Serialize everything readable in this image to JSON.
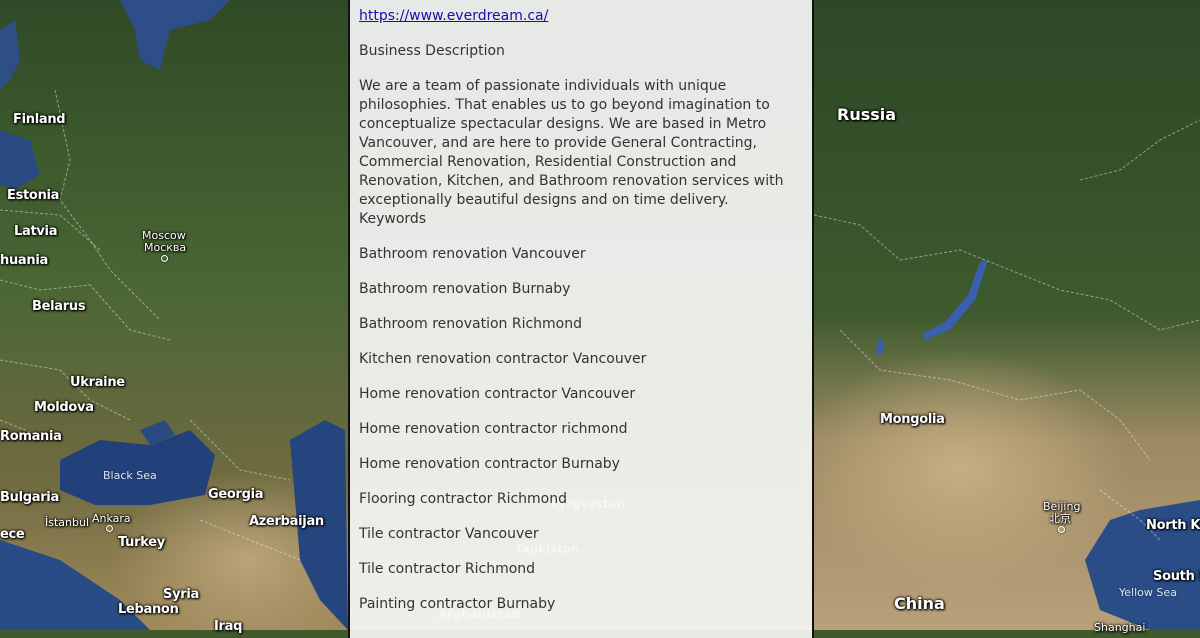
{
  "map": {
    "countries_left": [
      "Finland",
      "Estonia",
      "Latvia",
      "huania",
      "Belarus",
      "Ukraine",
      "Moldova",
      "Romania",
      "Bulgaria",
      "Georgia",
      "Azerbaijan",
      "Turkey",
      "Syria",
      "Lebanon",
      "Iraq",
      "ece"
    ],
    "cities": {
      "moscow": "Moscow",
      "moscow_native": "Москва",
      "istanbul": "İstanbul",
      "ankara": "Ankara",
      "beijing": "Beijing",
      "beijing_native": "北京",
      "shanghai": "Shanghai"
    },
    "seas": {
      "black_sea": "Black Sea",
      "yellow_sea": "Yellow Sea"
    },
    "countries_right": {
      "russia": "Russia",
      "mongolia": "Mongolia",
      "china": "China",
      "north_korea": "North Ko",
      "south_korea": "South K"
    },
    "under_panel": {
      "kyrgyzstan": "Kyrgyzstan",
      "tajikistan": "Tajikistan",
      "afghanistan": "Afghanistan"
    }
  },
  "panel": {
    "url": "https://www.everdream.ca/",
    "description_heading": "Business Description",
    "description": "We are a team of passionate individuals with unique philosophies. That enables us to go beyond imagination to conceptualize spectacular designs. We are based in Metro Vancouver, and are here to provide General Contracting, Commercial Renovation, Residential Construction and Renovation, Kitchen, and Bathroom renovation services with exceptionally beautiful designs and on time delivery.",
    "keywords_heading": "Keywords",
    "keywords": [
      "Bathroom renovation Vancouver",
      "Bathroom renovation Burnaby",
      "Bathroom renovation Richmond",
      "Kitchen renovation contractor Vancouver",
      "Home renovation contractor Vancouver",
      "Home renovation contractor richmond",
      "Home renovation contractor Burnaby",
      "Flooring contractor Richmond",
      "Tile contractor Vancouver",
      "Tile contractor Richmond",
      "Painting contractor Burnaby"
    ]
  }
}
